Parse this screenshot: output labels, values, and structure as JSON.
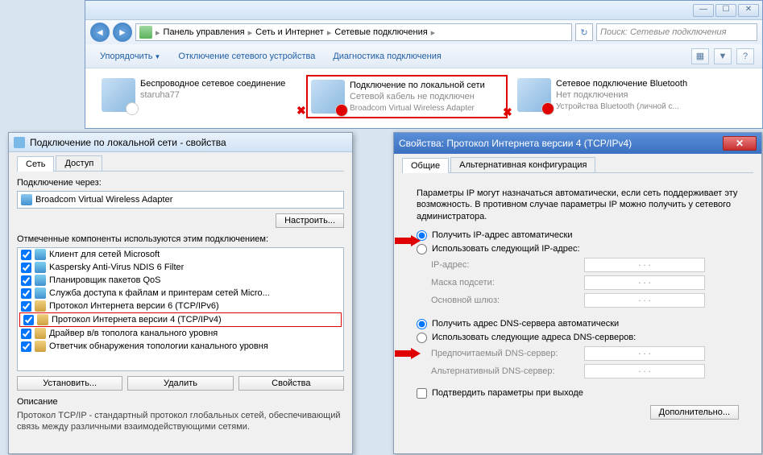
{
  "explorer": {
    "breadcrumb": {
      "p1": "Панель управления",
      "p2": "Сеть и Интернет",
      "p3": "Сетевые подключения"
    },
    "search_placeholder": "Поиск: Сетевые подключения",
    "toolbar": {
      "organize": "Упорядочить",
      "disable": "Отключение сетевого устройства",
      "diag": "Диагностика подключения"
    },
    "connections": [
      {
        "title": "Беспроводное сетевое соединение",
        "status": "staruha77",
        "detail": ""
      },
      {
        "title": "Подключение по локальной сети",
        "status": "Сетевой кабель не подключен",
        "detail": "Broadcom Virtual Wireless Adapter"
      },
      {
        "title": "Сетевое подключение Bluetooth",
        "status": "Нет подключения",
        "detail": "Устройства Bluetooth (личной с..."
      }
    ]
  },
  "props": {
    "title": "Подключение по локальной сети - свойства",
    "tabs": {
      "network": "Сеть",
      "access": "Доступ"
    },
    "connect_via_label": "Подключение через:",
    "adapter": "Broadcom Virtual Wireless Adapter",
    "configure_btn": "Настроить...",
    "components_label": "Отмеченные компоненты используются этим подключением:",
    "components": [
      "Клиент для сетей Microsoft",
      "Kaspersky Anti-Virus NDIS 6 Filter",
      "Планировщик пакетов QoS",
      "Служба доступа к файлам и принтерам сетей Micro...",
      "Протокол Интернета версии 6 (TCP/IPv6)",
      "Протокол Интернета версии 4 (TCP/IPv4)",
      "Драйвер в/в тополога канального уровня",
      "Ответчик обнаружения топологии канального уровня"
    ],
    "buttons": {
      "install": "Установить...",
      "remove": "Удалить",
      "props": "Свойства"
    },
    "desc_title": "Описание",
    "desc_text": "Протокол TCP/IP - стандартный протокол глобальных сетей, обеспечивающий связь между различными взаимодействующими сетями."
  },
  "ipv4": {
    "title": "Свойства: Протокол Интернета версии 4 (TCP/IPv4)",
    "tabs": {
      "general": "Общие",
      "alt": "Альтернативная конфигурация"
    },
    "info": "Параметры IP могут назначаться автоматически, если сеть поддерживает эту возможность. В противном случае параметры IP можно получить у сетевого администратора.",
    "r_auto_ip": "Получить IP-адрес автоматически",
    "r_manual_ip": "Использовать следующий IP-адрес:",
    "f_ip": "IP-адрес:",
    "f_mask": "Маска подсети:",
    "f_gw": "Основной шлюз:",
    "r_auto_dns": "Получить адрес DNS-сервера автоматически",
    "r_manual_dns": "Использовать следующие адреса DNS-серверов:",
    "f_dns1": "Предпочитаемый DNS-сервер:",
    "f_dns2": "Альтернативный DNS-сервер:",
    "chk_validate": "Подтвердить параметры при выходе",
    "advanced_btn": "Дополнительно...",
    "ip_dots": ".       .       ."
  }
}
